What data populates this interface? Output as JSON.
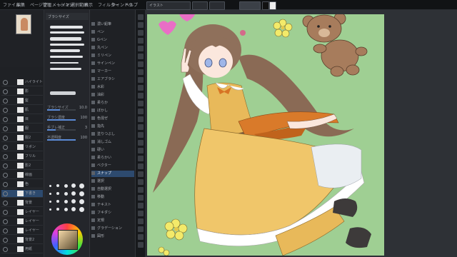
{
  "app": {
    "accent_color": "#2d4a6e",
    "canvas_bg": "#9fcf93"
  },
  "menu": {
    "items": [
      "ファイル",
      "編集",
      "ページ管理",
      "アニメーション",
      "レイヤー",
      "選択範囲",
      "表示",
      "フィルター",
      "ウィンドウ",
      "ヘルプ"
    ]
  },
  "layers": {
    "rows": [
      "ハイライト",
      "影",
      "髪",
      "肌",
      "目",
      "服",
      "服2",
      "リボン",
      "フリル",
      "影2",
      "線画",
      "色",
      "下書き",
      "背景",
      "レイヤー",
      "レイヤー",
      "レイヤー",
      "背景2",
      "用紙"
    ],
    "selected_index": 12
  },
  "brush": {
    "header": "ブラシサイズ",
    "sliders": [
      {
        "name": "ブラシサイズ",
        "value": "10.0",
        "level": 0.45
      },
      {
        "name": "ブラシ濃度",
        "value": "100",
        "level": 1.0
      },
      {
        "name": "手ブレ補正",
        "value": "3",
        "level": 0.3
      },
      {
        "name": "不透明度",
        "value": "100",
        "level": 1.0
      }
    ]
  },
  "tools": {
    "items": [
      "濃い鉛筆",
      "ペン",
      "Gペン",
      "丸ペン",
      "ミリペン",
      "サインペン",
      "マーカー",
      "エアブラシ",
      "水彩",
      "油彩",
      "柔らか",
      "ぼかし",
      "色混ぜ",
      "指先",
      "塗りつぶし",
      "消しゴム",
      "硬い",
      "柔らかい",
      "ベクター",
      "スナップ",
      "選択",
      "自動選択",
      "移動",
      "テキスト",
      "フキダシ",
      "定規",
      "グラデーション",
      "図形"
    ],
    "active_index": 19
  },
  "doc": {
    "tab_label": "イラスト"
  }
}
